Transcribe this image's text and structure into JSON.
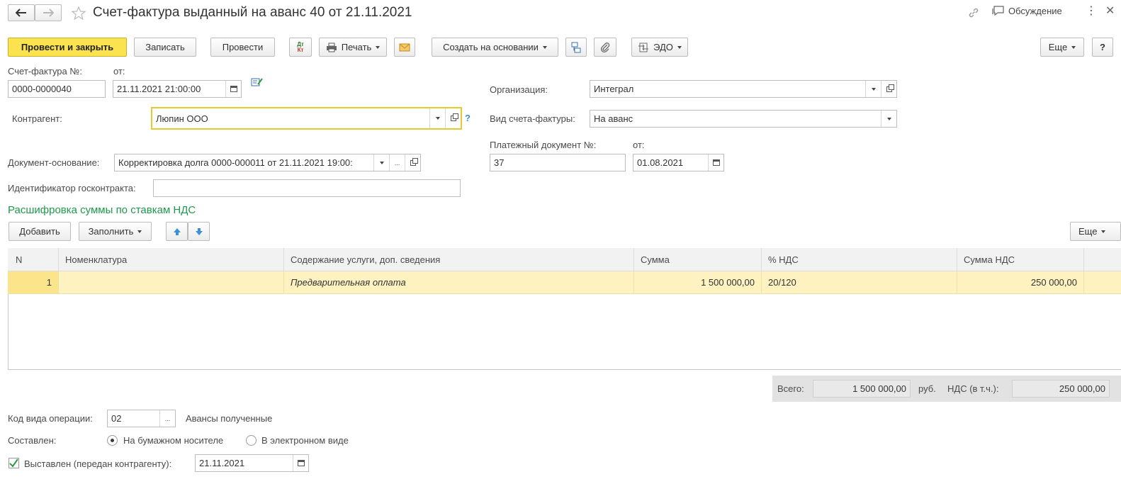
{
  "header": {
    "title": "Счет-фактура выданный на аванс 40 от 21.11.2021",
    "discussion": "Обсуждение"
  },
  "toolbar": {
    "post_close": "Провести и закрыть",
    "save": "Записать",
    "post": "Провести",
    "dt_kt_top": "Дт",
    "dt_kt_bottom": "Кт",
    "print": "Печать",
    "create_based": "Создать на основании",
    "edo": "ЭДО",
    "more": "Еще",
    "help": "?"
  },
  "form": {
    "invoice_no_label": "Счет-фактура №:",
    "date_from_label": "от:",
    "invoice_no": "0000-0000040",
    "invoice_date": "21.11.2021 21:00:00",
    "org_label": "Организация:",
    "org_value": "Интеграл",
    "counterparty_label": "Контрагент:",
    "counterparty_value": "Люпин ООО",
    "help_mark": "?",
    "invoice_kind_label": "Вид счета-фактуры:",
    "invoice_kind_value": "На аванс",
    "payment_doc_label": "Платежный документ №:",
    "payment_from_label": "от:",
    "payment_doc_no": "37",
    "payment_doc_date": "01.08.2021",
    "base_doc_label": "Документ-основание:",
    "base_doc_value": "Корректировка долга 0000-000011 от 21.11.2021 19:00:",
    "ellipsis": "...",
    "gov_contract_label": "Идентификатор госконтракта:",
    "gov_contract_value": ""
  },
  "vat_section": {
    "title": "Расшифровка суммы по ставкам НДС",
    "add": "Добавить",
    "fill": "Заполнить",
    "more": "Еще",
    "columns": [
      "N",
      "Номенклатура",
      "Содержание услуги, доп. сведения",
      "Сумма",
      "% НДС",
      "Сумма НДС"
    ],
    "rows": [
      {
        "n": "1",
        "item": "",
        "content": "Предварительная оплата",
        "sum": "1 500 000,00",
        "rate": "20/120",
        "vat": "250 000,00"
      }
    ]
  },
  "totals": {
    "total_label": "Всего:",
    "total_value": "1 500 000,00",
    "currency": "руб.",
    "vat_label": "НДС (в т.ч.):",
    "vat_value": "250 000,00"
  },
  "footer": {
    "op_code_label": "Код вида операции:",
    "op_code_value": "02",
    "op_code_ellipsis": "...",
    "op_code_desc": "Авансы полученные",
    "composed_label": "Составлен:",
    "paper": "На бумажном носителе",
    "electronic": "В электронном виде",
    "issued_label": "Выставлен (передан контрагенту):",
    "issued_date": "21.11.2021"
  },
  "colors": {
    "primary_button": "#fbe24f",
    "section_title": "#1e9a4b",
    "selected_row": "#fdf2c0",
    "focus_border": "#e6c830",
    "arrow_blue": "#3d8fd6"
  }
}
